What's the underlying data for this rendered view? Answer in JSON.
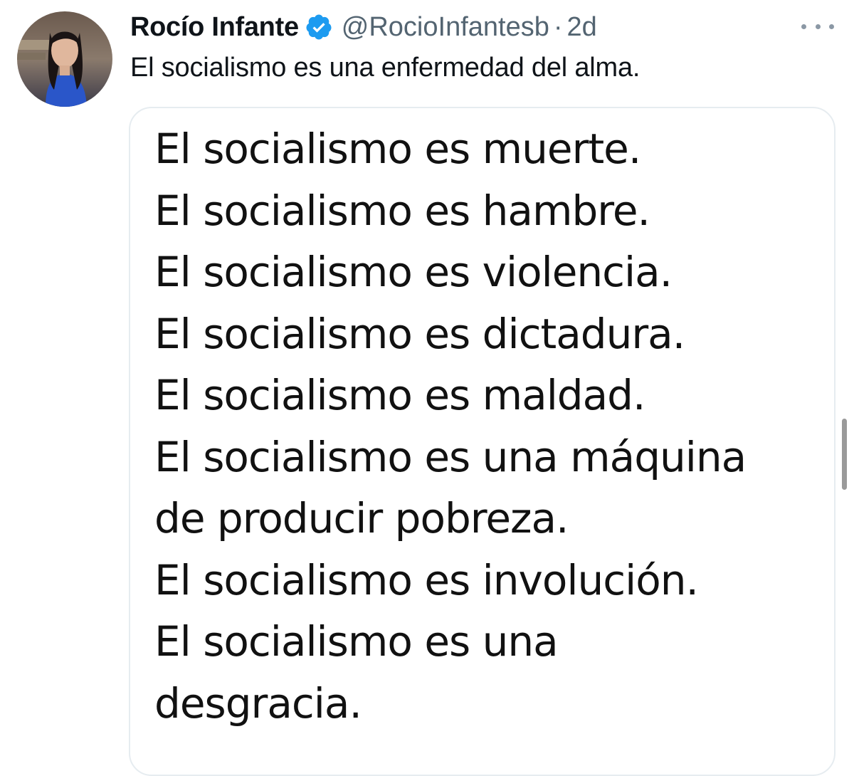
{
  "tweet": {
    "author": {
      "display_name": "Rocío Infante",
      "verified": true,
      "verified_icon": "verified-badge-icon",
      "handle": "@RocioInfantesb",
      "separator": "·",
      "timestamp": "2d"
    },
    "text": "El socialismo es una enfermedad del alma.",
    "more_icon": "more-options-icon",
    "media_image": {
      "lines": [
        "El socialismo es muerte.",
        "El socialismo es hambre.",
        "El socialismo es violencia.",
        "El socialismo es dictadura.",
        "El socialismo es maldad.",
        "El socialismo es una máquina",
        "de producir pobreza.",
        "El socialismo es involución.",
        "El socialismo es una",
        "desgracia."
      ]
    }
  },
  "colors": {
    "primary_text": "#0f1419",
    "secondary_text": "#536471",
    "verified_blue": "#1d9bf0",
    "border": "#e6ecf0"
  }
}
